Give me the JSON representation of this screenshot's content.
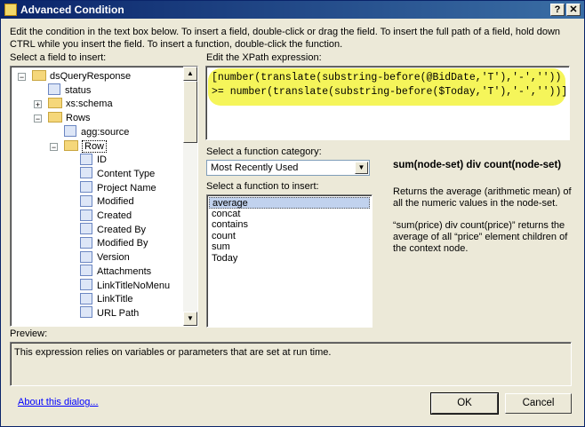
{
  "window": {
    "title": "Advanced Condition",
    "help_glyph": "?",
    "close_glyph": "✕"
  },
  "instructions": "Edit the condition in the text box below. To insert a field, double-click or drag the field. To insert the full path of a field, hold down CTRL while you insert the field. To insert a function, double-click the function.",
  "field_panel": {
    "label": "Select a field to insert:",
    "tree": [
      {
        "label": "dsQueryResponse",
        "icon": "folder-open-icon",
        "expander": "−"
      },
      {
        "label": "status",
        "icon": "field-icon"
      },
      {
        "label": "xs:schema",
        "icon": "folder-icon",
        "expander": "+"
      },
      {
        "label": "Rows",
        "icon": "folder-open-icon",
        "expander": "−"
      },
      {
        "label": "agg:source",
        "icon": "field-icon"
      },
      {
        "label": "Row",
        "icon": "folder-open-icon",
        "expander": "−"
      },
      {
        "label": "ID",
        "icon": "field-icon"
      },
      {
        "label": "Content Type",
        "icon": "field-icon"
      },
      {
        "label": "Project Name",
        "icon": "field-icon"
      },
      {
        "label": "Modified",
        "icon": "field-icon"
      },
      {
        "label": "Created",
        "icon": "field-icon"
      },
      {
        "label": "Created By",
        "icon": "field-icon"
      },
      {
        "label": "Modified By",
        "icon": "field-icon"
      },
      {
        "label": "Version",
        "icon": "field-icon"
      },
      {
        "label": "Attachments",
        "icon": "field-icon"
      },
      {
        "label": "LinkTitleNoMenu",
        "icon": "field-icon"
      },
      {
        "label": "LinkTitle",
        "icon": "field-icon"
      },
      {
        "label": "URL Path",
        "icon": "field-icon"
      }
    ]
  },
  "xpath_panel": {
    "label": "Edit the XPath expression:",
    "lines": [
      "[number(translate(substring-before(@BidDate,'T'),'-',''))",
      ">= number(translate(substring-before($Today,'T'),'-',''))]"
    ]
  },
  "function_panel": {
    "category_label": "Select a function category:",
    "category_value": "Most Recently Used",
    "function_label": "Select a function to insert:",
    "functions": [
      "average",
      "concat",
      "contains",
      "count",
      "sum",
      "Today"
    ],
    "selected_function": "average"
  },
  "description": {
    "signature": "sum(node-set) div count(node-set)",
    "text1": "Returns the average (arithmetic mean) of all the numeric values in the node-set.",
    "text2": "“sum(price) div count(price)” returns the average of all “price” element children of the context node."
  },
  "preview": {
    "label": "Preview:",
    "text": "This expression relies on variables or parameters that are set at run time."
  },
  "footer": {
    "about_link": "About this dialog...",
    "ok_label": "OK",
    "cancel_label": "Cancel"
  }
}
